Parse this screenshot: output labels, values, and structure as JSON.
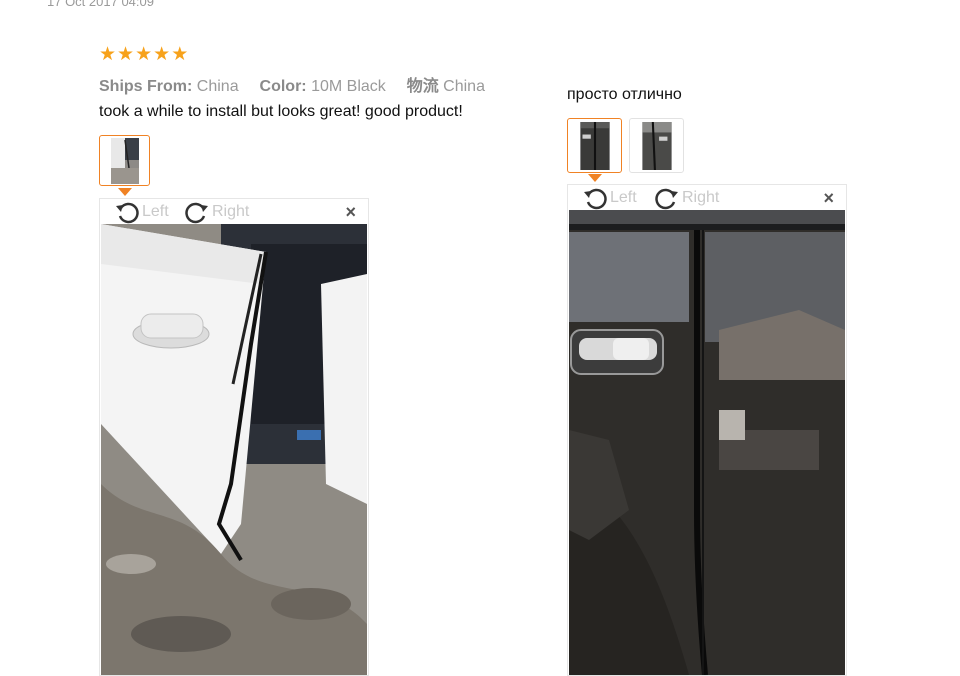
{
  "review_date": "17 Oct 2017 04:09",
  "review1": {
    "rating_stars": 5,
    "ships_from_label": "Ships From:",
    "ships_from_value": "China",
    "color_label": "Color:",
    "color_value": "10M Black",
    "logistics_label": "物流",
    "logistics_value": "China",
    "text": "took a while to install but looks great! good product!",
    "viewer": {
      "left_label": "Left",
      "right_label": "Right",
      "close_symbol": "×"
    }
  },
  "review2": {
    "text": "просто отлично",
    "viewer": {
      "left_label": "Left",
      "right_label": "Right",
      "close_symbol": "×"
    }
  },
  "colors": {
    "accent": "#f08224",
    "star": "#f7a21b",
    "muted": "#9a9a9a"
  },
  "icons": [
    "star-icon",
    "rotate-left-icon",
    "rotate-right-icon",
    "close-icon"
  ]
}
